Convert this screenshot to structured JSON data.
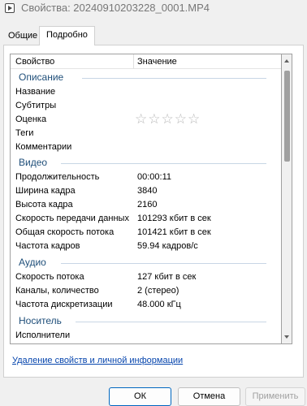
{
  "window": {
    "title": "Свойства: 20240910203228_0001.MP4"
  },
  "tabs": [
    {
      "label": "Общие",
      "active": false
    },
    {
      "label": "Подробно",
      "active": true
    }
  ],
  "columns": {
    "property": "Свойство",
    "value": "Значение"
  },
  "groups": {
    "description": {
      "label": "Описание",
      "rows": [
        {
          "name": "Название",
          "value": ""
        },
        {
          "name": "Субтитры",
          "value": ""
        },
        {
          "name": "Оценка",
          "value": "☆☆☆☆☆",
          "rating_stars": 0,
          "rating_max": 5
        },
        {
          "name": "Теги",
          "value": ""
        },
        {
          "name": "Комментарии",
          "value": ""
        }
      ]
    },
    "video": {
      "label": "Видео",
      "rows": [
        {
          "name": "Продолжительность",
          "value": "00:00:11"
        },
        {
          "name": "Ширина кадра",
          "value": "3840"
        },
        {
          "name": "Высота кадра",
          "value": "2160"
        },
        {
          "name": "Скорость передачи данных",
          "value": "101293 кбит в сек"
        },
        {
          "name": "Общая скорость потока",
          "value": "101421 кбит в сек"
        },
        {
          "name": "Частота кадров",
          "value": "59.94 кадров/с"
        }
      ]
    },
    "audio": {
      "label": "Аудио",
      "rows": [
        {
          "name": "Скорость потока",
          "value": "127 кбит в сек"
        },
        {
          "name": "Каналы, количество",
          "value": "2 (стерео)"
        },
        {
          "name": "Частота дискретизации",
          "value": "48.000 кГц"
        }
      ]
    },
    "media": {
      "label": "Носитель",
      "rows": [
        {
          "name": "Исполнители",
          "value": ""
        }
      ]
    }
  },
  "link": {
    "label": "Удаление свойств и личной информации"
  },
  "buttons": {
    "ok": "ОК",
    "cancel": "Отмена",
    "apply": "Применить"
  }
}
